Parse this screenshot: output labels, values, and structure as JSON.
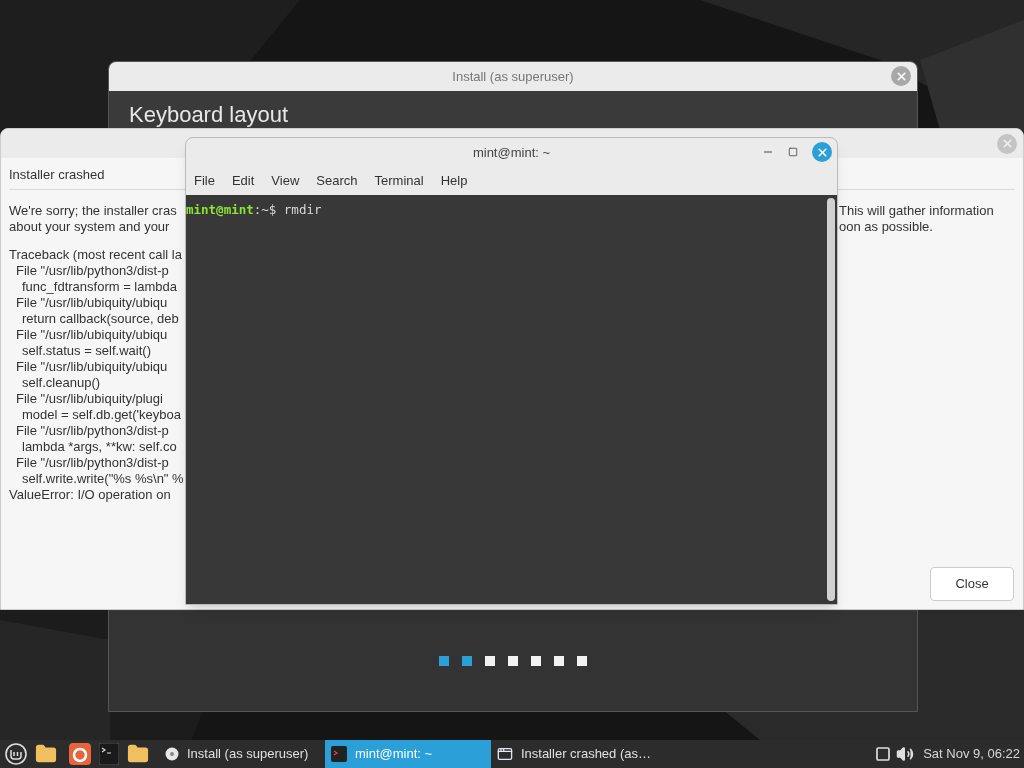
{
  "install_window": {
    "title": "Install (as superuser)",
    "heading": "Keyboard layout",
    "steps": [
      {
        "done": true
      },
      {
        "done": true
      },
      {
        "done": false
      },
      {
        "done": false
      },
      {
        "done": false
      },
      {
        "done": false
      },
      {
        "done": false
      }
    ]
  },
  "crash_dialog": {
    "heading": "Installer crashed",
    "intro_left": [
      "We're sorry; the installer cras",
      "about your system and your"
    ],
    "intro_right": [
      "This will gather information",
      "oon as possible."
    ],
    "traceback": [
      {
        "kind": "header",
        "text": "Traceback (most recent call la"
      },
      {
        "kind": "file",
        "text": "File \"/usr/lib/python3/dist-p"
      },
      {
        "kind": "code",
        "text": "func_fdtransform = lambda"
      },
      {
        "kind": "file",
        "text": "File \"/usr/lib/ubiquity/ubiqu"
      },
      {
        "kind": "code",
        "text": "return callback(source, deb"
      },
      {
        "kind": "file",
        "text": "File \"/usr/lib/ubiquity/ubiqu"
      },
      {
        "kind": "code",
        "text": "self.status = self.wait()"
      },
      {
        "kind": "file",
        "text": "File \"/usr/lib/ubiquity/ubiqu"
      },
      {
        "kind": "code",
        "text": "self.cleanup()"
      },
      {
        "kind": "file",
        "text": "File \"/usr/lib/ubiquity/plugi"
      },
      {
        "kind": "code",
        "text": "model = self.db.get('keyboa"
      },
      {
        "kind": "file",
        "text": "File \"/usr/lib/python3/dist-p"
      },
      {
        "kind": "code",
        "text": "lambda *args, **kw: self.co"
      },
      {
        "kind": "file",
        "text": "File \"/usr/lib/python3/dist-p"
      },
      {
        "kind": "code",
        "text": "self.write.write(\"%s %s\\n\" %"
      },
      {
        "kind": "header",
        "text": "ValueError: I/O operation on"
      }
    ],
    "close_button": "Close"
  },
  "terminal": {
    "title": "mint@mint: ~",
    "menu": [
      "File",
      "Edit",
      "View",
      "Search",
      "Terminal",
      "Help"
    ],
    "prompt_user": "mint@mint",
    "prompt_rest": ":~$ rmdir"
  },
  "taskbar": {
    "tasks": [
      {
        "kind": "disc",
        "title": "Install (as superuser)",
        "selected": false
      },
      {
        "kind": "terminal",
        "title": "mint@mint: ~",
        "selected": true
      },
      {
        "kind": "window",
        "title": "Installer crashed (as…",
        "selected": false
      }
    ],
    "clock": "Sat Nov 9, 06:22"
  }
}
